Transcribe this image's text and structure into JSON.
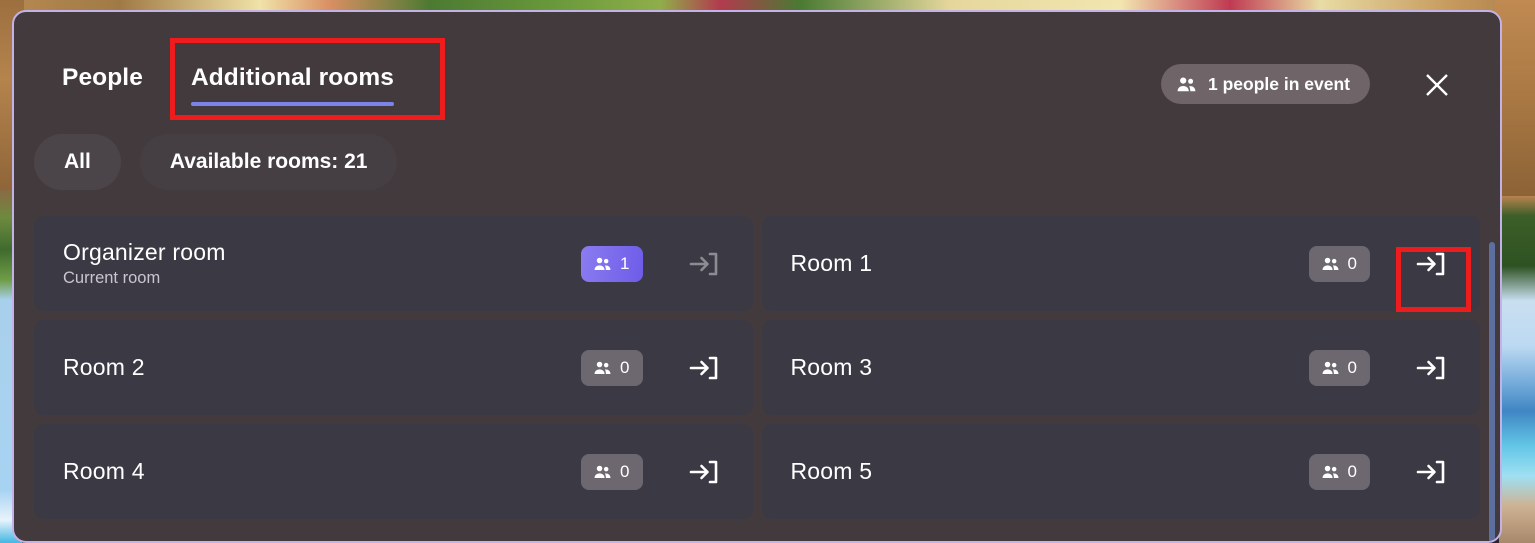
{
  "panel": {
    "accent_color": "#7b83eb",
    "border_color": "#c3b2e8",
    "background_color": "#423a3d",
    "card_color": "#3b3944",
    "highlight_color": "#ee1c1c"
  },
  "header": {
    "tabs": [
      {
        "label": "People",
        "active": false
      },
      {
        "label": "Additional rooms",
        "active": true
      }
    ],
    "people_badge": {
      "icon": "people-icon",
      "label": "1 people in event"
    },
    "close_icon": "close-icon"
  },
  "filters": [
    {
      "label": "All",
      "selected": true
    },
    {
      "label": "Available rooms: 21",
      "selected": false
    }
  ],
  "rooms": [
    {
      "title": "Organizer room",
      "subtitle": "Current room",
      "count": "1",
      "badge_style": "purple",
      "enter_icon": "enter-room-icon",
      "enter_enabled": false
    },
    {
      "title": "Room 1",
      "subtitle": "",
      "count": "0",
      "badge_style": "grey",
      "enter_icon": "enter-room-icon",
      "enter_enabled": true
    },
    {
      "title": "Room 2",
      "subtitle": "",
      "count": "0",
      "badge_style": "grey",
      "enter_icon": "enter-room-icon",
      "enter_enabled": true
    },
    {
      "title": "Room 3",
      "subtitle": "",
      "count": "0",
      "badge_style": "grey",
      "enter_icon": "enter-room-icon",
      "enter_enabled": true
    },
    {
      "title": "Room 4",
      "subtitle": "",
      "count": "0",
      "badge_style": "grey",
      "enter_icon": "enter-room-icon",
      "enter_enabled": true
    },
    {
      "title": "Room 5",
      "subtitle": "",
      "count": "0",
      "badge_style": "grey",
      "enter_icon": "enter-room-icon",
      "enter_enabled": true
    }
  ],
  "scrollbar": {
    "name": "rooms-scrollbar"
  }
}
